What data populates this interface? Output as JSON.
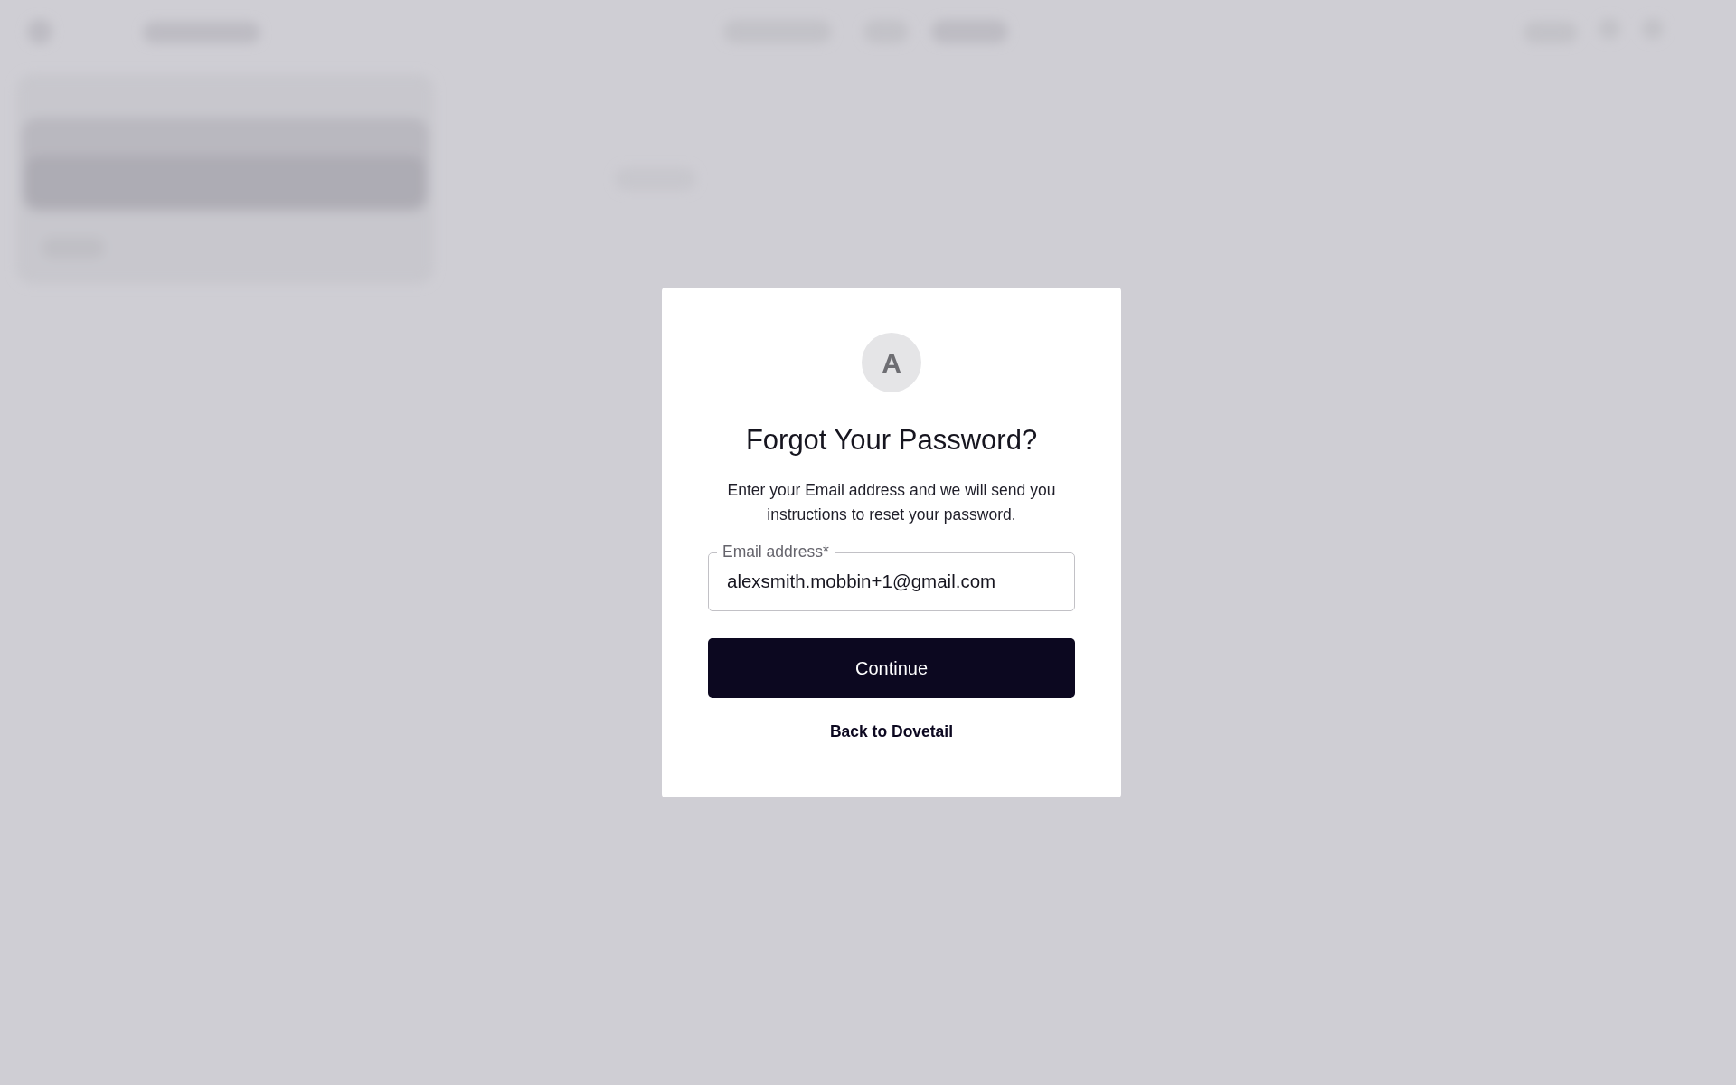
{
  "dialog": {
    "avatar": "A",
    "title": "Forgot Your Password?",
    "description": "Enter your Email address and we will send you instructions to reset your password.",
    "email_field": {
      "label": "Email address",
      "required_mark": "*",
      "value": "alexsmith.mobbin+1@gmail.com"
    },
    "continue_button": "Continue",
    "back_link": "Back to Dovetail"
  }
}
